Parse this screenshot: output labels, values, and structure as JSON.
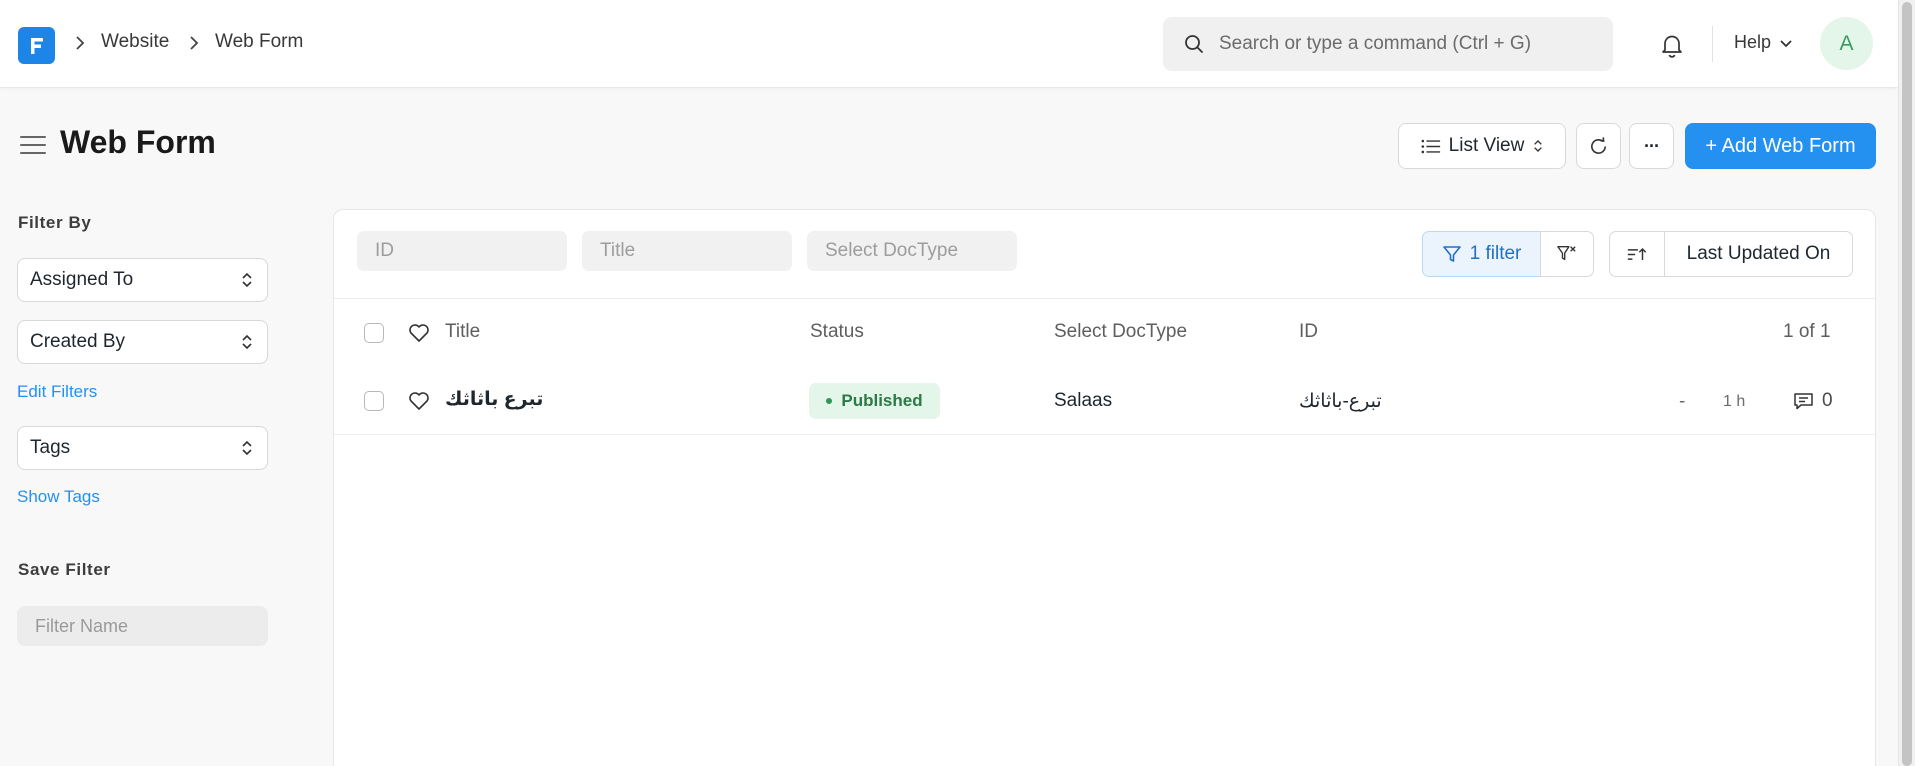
{
  "breadcrumbs": [
    "Website",
    "Web Form"
  ],
  "search": {
    "placeholder": "Search or type a command (Ctrl + G)"
  },
  "nav": {
    "help_label": "Help",
    "avatar_initial": "A"
  },
  "page": {
    "title": "Web Form",
    "view_label": "List View",
    "more_label": "···",
    "add_label": "+ Add Web Form"
  },
  "sidebar": {
    "filter_by_heading": "Filter By",
    "assigned_to": "Assigned To",
    "created_by": "Created By",
    "edit_filters": "Edit Filters",
    "tags": "Tags",
    "show_tags": "Show Tags",
    "save_filter_heading": "Save Filter",
    "filter_name_placeholder": "Filter Name"
  },
  "list": {
    "filters": {
      "id_placeholder": "ID",
      "title_placeholder": "Title",
      "doctype_placeholder": "Select DocType",
      "filter_count_label": "1 filter",
      "sort_label": "Last Updated On"
    },
    "columns": {
      "title": "Title",
      "status": "Status",
      "doctype": "Select DocType",
      "id": "ID",
      "count": "1 of 1"
    },
    "rows": [
      {
        "title": "تبرع باثاثك",
        "status": "Published",
        "doctype": "Salaas",
        "id": "تبرع-باثاثك",
        "dash": "-",
        "modified": "1 h",
        "comments": "0"
      }
    ]
  },
  "colors": {
    "primary": "#2490ef",
    "logo": "#1e85e8",
    "status_published_bg": "#e4f5e9",
    "status_published_text": "#2c7a45",
    "avatar_bg": "#e4f5e9",
    "avatar_text": "#3a9b5c"
  }
}
